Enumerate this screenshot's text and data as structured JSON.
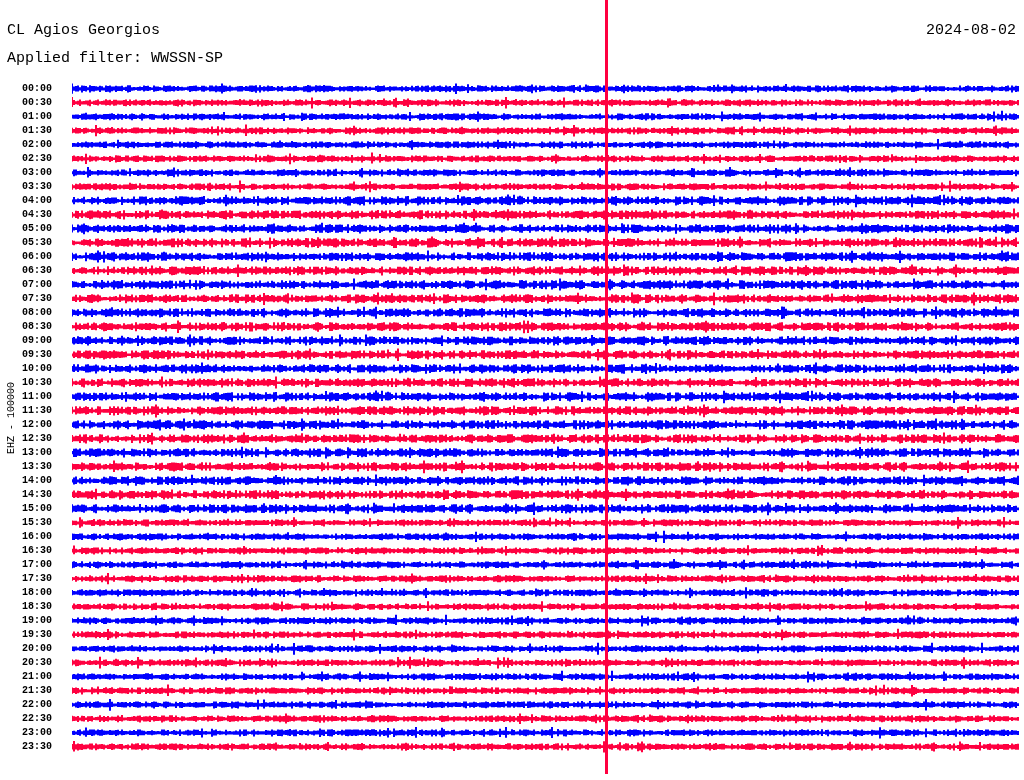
{
  "header": {
    "station": "CL Agios Georgios",
    "date": "2024-08-02",
    "filter": "Applied filter: WWSSN-SP"
  },
  "axis_label": "EHZ - 100000",
  "rows": [
    {
      "time": "00:00",
      "color": "#0000ff"
    },
    {
      "time": "00:30",
      "color": "#ff0040"
    },
    {
      "time": "01:00",
      "color": "#0000ff"
    },
    {
      "time": "01:30",
      "color": "#ff0040"
    },
    {
      "time": "02:00",
      "color": "#0000ff"
    },
    {
      "time": "02:30",
      "color": "#ff0040"
    },
    {
      "time": "03:00",
      "color": "#0000ff"
    },
    {
      "time": "03:30",
      "color": "#ff0040"
    },
    {
      "time": "04:00",
      "color": "#0000ff"
    },
    {
      "time": "04:30",
      "color": "#ff0040"
    },
    {
      "time": "05:00",
      "color": "#0000ff"
    },
    {
      "time": "05:30",
      "color": "#ff0040"
    },
    {
      "time": "06:00",
      "color": "#0000ff"
    },
    {
      "time": "06:30",
      "color": "#ff0040"
    },
    {
      "time": "07:00",
      "color": "#0000ff"
    },
    {
      "time": "07:30",
      "color": "#ff0040"
    },
    {
      "time": "08:00",
      "color": "#0000ff"
    },
    {
      "time": "08:30",
      "color": "#ff0040"
    },
    {
      "time": "09:00",
      "color": "#0000ff"
    },
    {
      "time": "09:30",
      "color": "#ff0040"
    },
    {
      "time": "10:00",
      "color": "#0000ff"
    },
    {
      "time": "10:30",
      "color": "#ff0040"
    },
    {
      "time": "11:00",
      "color": "#0000ff"
    },
    {
      "time": "11:30",
      "color": "#ff0040"
    },
    {
      "time": "12:00",
      "color": "#0000ff"
    },
    {
      "time": "12:30",
      "color": "#ff0040"
    },
    {
      "time": "13:00",
      "color": "#0000ff"
    },
    {
      "time": "13:30",
      "color": "#ff0040"
    },
    {
      "time": "14:00",
      "color": "#0000ff"
    },
    {
      "time": "14:30",
      "color": "#ff0040"
    },
    {
      "time": "15:00",
      "color": "#0000ff"
    },
    {
      "time": "15:30",
      "color": "#ff0040"
    },
    {
      "time": "16:00",
      "color": "#0000ff"
    },
    {
      "time": "16:30",
      "color": "#ff0040"
    },
    {
      "time": "17:00",
      "color": "#0000ff"
    },
    {
      "time": "17:30",
      "color": "#ff0040"
    },
    {
      "time": "18:00",
      "color": "#0000ff"
    },
    {
      "time": "18:30",
      "color": "#ff0040"
    },
    {
      "time": "19:00",
      "color": "#0000ff"
    },
    {
      "time": "19:30",
      "color": "#ff0040"
    },
    {
      "time": "20:00",
      "color": "#0000ff"
    },
    {
      "time": "20:30",
      "color": "#ff0040"
    },
    {
      "time": "21:00",
      "color": "#0000ff"
    },
    {
      "time": "21:30",
      "color": "#ff0040"
    },
    {
      "time": "22:00",
      "color": "#0000ff"
    },
    {
      "time": "22:30",
      "color": "#ff0040"
    },
    {
      "time": "23:00",
      "color": "#0000ff"
    },
    {
      "time": "23:30",
      "color": "#ff0040"
    }
  ]
}
